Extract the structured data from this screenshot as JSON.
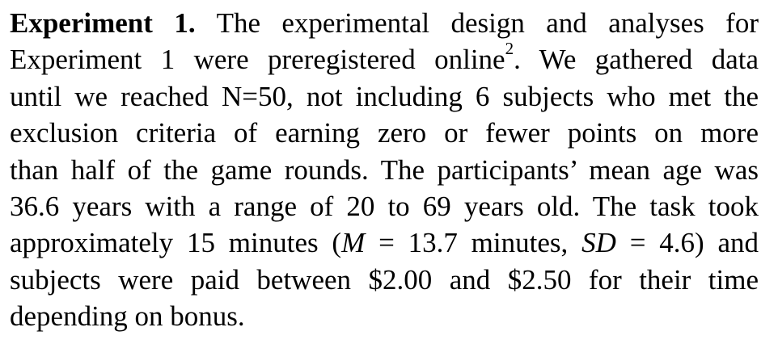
{
  "section": {
    "heading": "Experiment 1.",
    "lines": {
      "l1": "The experimental design and analyses for",
      "l2a": "Experiment 1 were preregistered online",
      "l2_footnote": "2",
      "l2b": ". We gathered data",
      "l3": "until we reached N=50, not including 6 subjects who met the",
      "l4": "exclusion criteria of earning zero or fewer points on more",
      "l5": "than half of the game rounds. The participants’ mean age was",
      "l6": "36.6 years with a range of 20 to 69 years old. The task took",
      "l7a": "approximately 15 minutes (",
      "l7_var_m": "M",
      "l7b": " = 13.7 minutes, ",
      "l7_var_sd": "SD",
      "l7c": " = 4.6) and",
      "l8": "subjects were paid between $2.00 and $2.50 for their time",
      "l9": "depending on bonus."
    }
  }
}
